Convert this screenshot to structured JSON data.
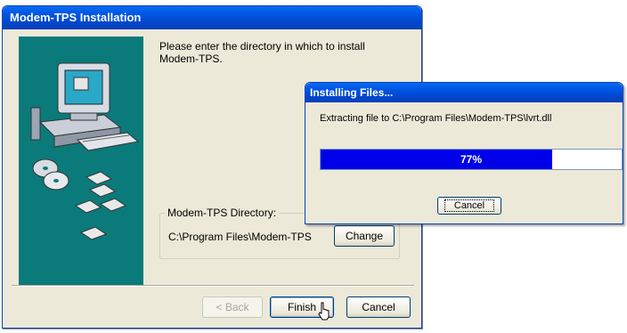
{
  "installer": {
    "title": "Modem-TPS Installation",
    "instruction": "Please enter the directory in which to install Modem-TPS.",
    "directory_group_label": "Modem-TPS Directory:",
    "directory_path": "C:\\Program Files\\Modem-TPS",
    "change_label": "Change",
    "back_label": "< Back",
    "finish_label": "Finish",
    "cancel_label": "Cancel"
  },
  "progress_dialog": {
    "title": "Installing Files...",
    "status_text": "Extracting file to C:\\Program Files\\Modem-TPS\\lvrt.dll",
    "percent_label": "77%",
    "progress_fraction": 0.77,
    "cancel_label": "Cancel"
  },
  "colors": {
    "titlebar": "#0054e3",
    "panel": "#0b7a7a",
    "progress_fill": "#0000e8",
    "window_bg": "#ece9d8"
  },
  "icons": {
    "computer": "computer-icon",
    "cd": "cd-icon",
    "floppy": "floppy-disk-icon",
    "cursor": "mouse-cursor-icon"
  }
}
